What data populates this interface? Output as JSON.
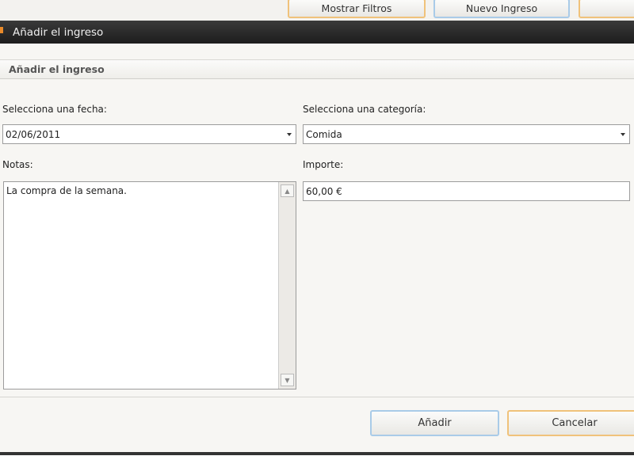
{
  "toolbar": {
    "show_filters": "Mostrar Filtros",
    "new_income": "Nuevo Ingreso"
  },
  "window": {
    "title": "Añadir el ingreso"
  },
  "form": {
    "section_title": "Añadir el ingreso",
    "date_label": "Selecciona una fecha:",
    "date_value": "02/06/2011",
    "category_label": "Selecciona una categoría:",
    "category_value": "Comida",
    "notes_label": "Notas:",
    "notes_value": "La compra de la semana.",
    "amount_label": "Importe:",
    "amount_value": "60,00 €",
    "add_button": "Añadir",
    "cancel_button": "Cancelar"
  },
  "colors": {
    "title_bar": "#262626",
    "accent_orange": "#f0c27a",
    "accent_blue": "#a9cbe8"
  }
}
